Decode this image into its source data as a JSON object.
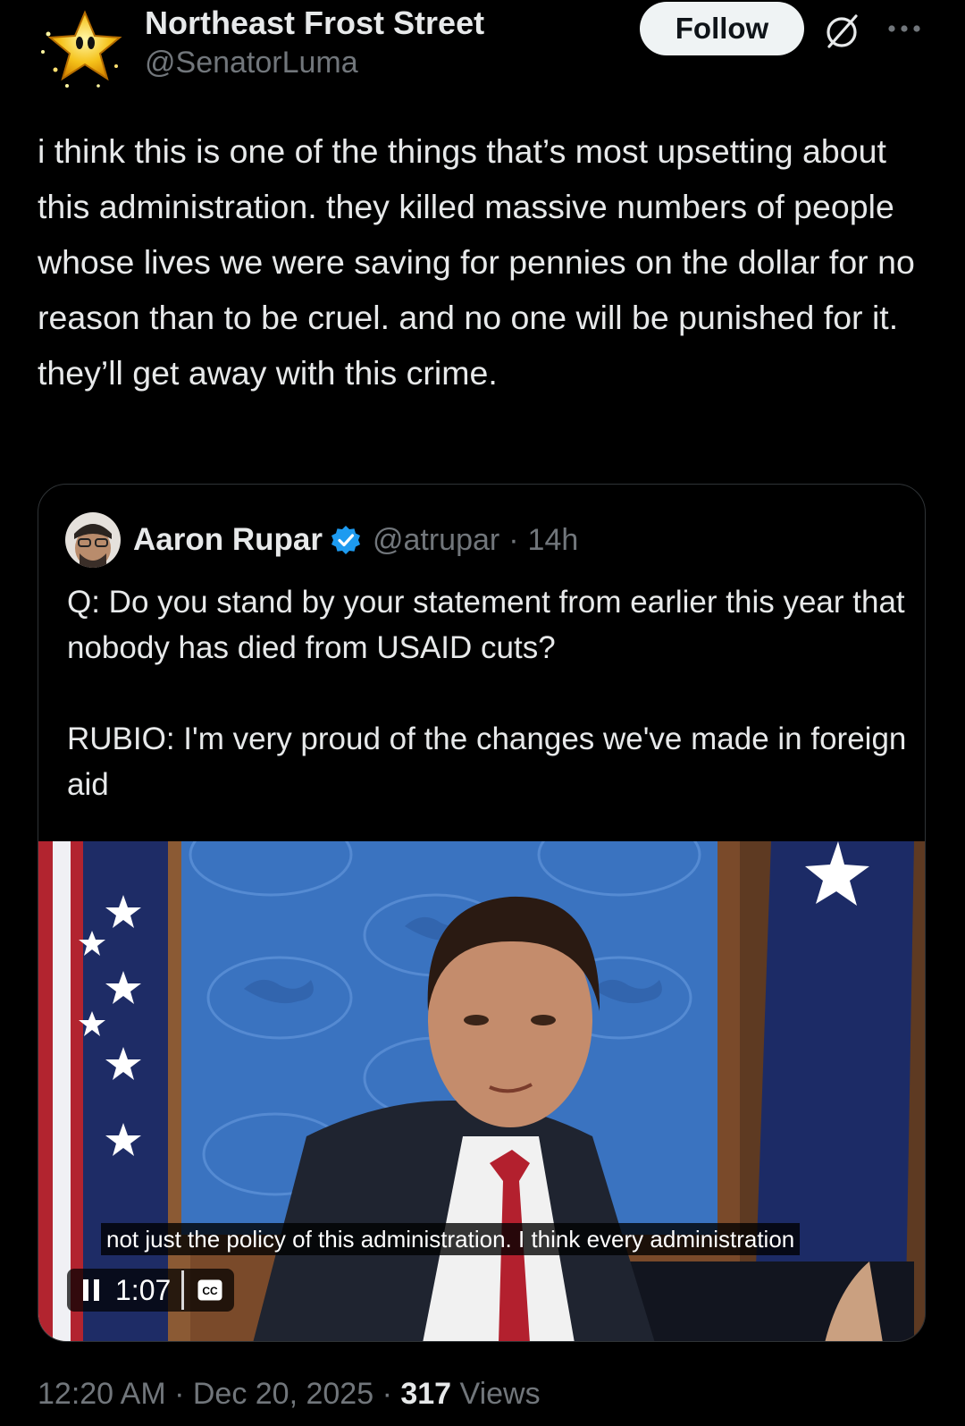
{
  "post": {
    "display_name": "Northeast Frost Street",
    "handle": "@SenatorLuma",
    "follow_label": "Follow",
    "text": "i think this is one of the things that’s most upsetting about this administration. they killed massive numbers of people whose lives we were saving for pennies on the dollar for no reason than to be cruel. and no one will be punished for it. they’ll get away with this crime.",
    "timestamp": "12:20 AM · Dec 20, 2025 · ",
    "views_count": "317",
    "views_label": " Views",
    "icons": [
      "star-avatar-icon",
      "grok-icon",
      "more-icon"
    ]
  },
  "quote": {
    "display_name": "Aaron Rupar",
    "handle": "@atrupar",
    "dot": "·",
    "time": "14h",
    "text": "Q: Do you stand by your statement from earlier this year that nobody has died from USAID cuts?\n\nRUBIO: I'm very proud of the changes we've made in foreign aid",
    "video": {
      "caption": "not just the policy of this administration. I think every administration",
      "time": "1:07",
      "cc_label": "CC"
    },
    "icons": [
      "verified-badge-icon",
      "pause-icon",
      "closed-captions-icon"
    ]
  },
  "colors": {
    "background": "#000000",
    "text_primary": "#e7e9ea",
    "text_secondary": "#71767b",
    "border": "#2f3336",
    "verified": "#1d9bf0",
    "follow_bg": "#eff3f4"
  }
}
